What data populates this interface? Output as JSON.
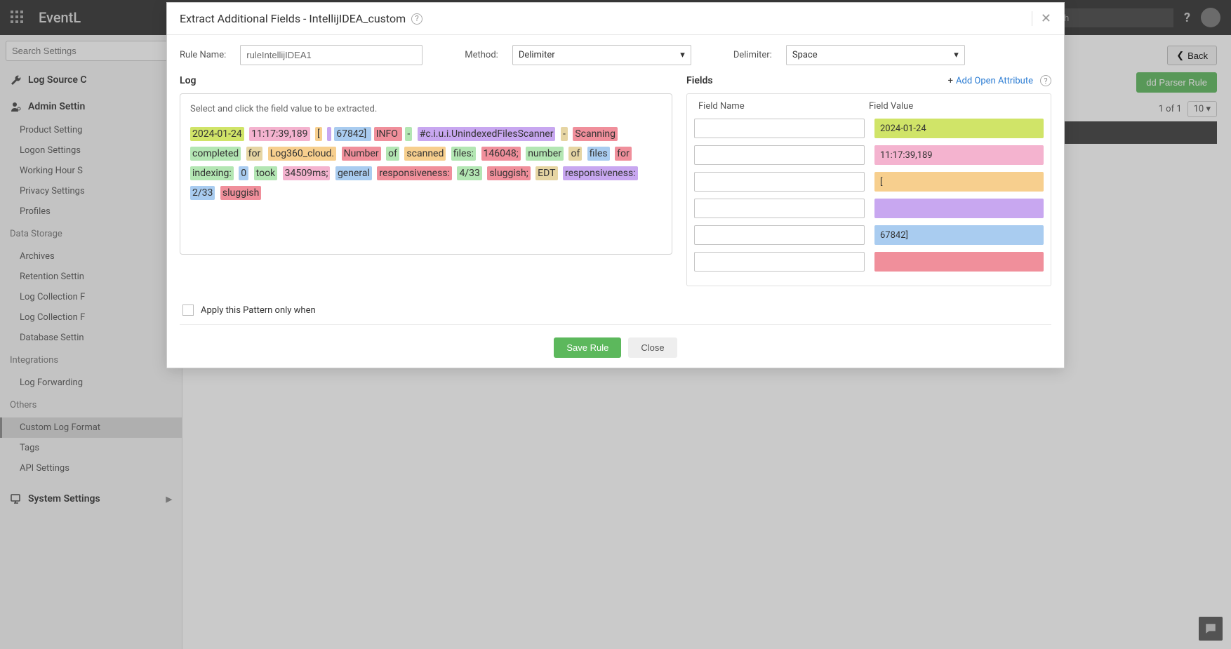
{
  "topbar": {
    "brand": "EventL",
    "search_placeholder": "Search",
    "help_label": "?"
  },
  "sidebar": {
    "search_placeholder": "Search Settings",
    "groups": {
      "log_source": "Log Source C",
      "admin": "Admin Settin",
      "data_storage": "Data Storage",
      "integrations": "Integrations",
      "others": "Others",
      "system": "System Settings"
    },
    "items": {
      "product_setting": "Product Setting",
      "logon_settings": "Logon Settings",
      "working_hour": "Working Hour S",
      "privacy": "Privacy Settings",
      "profiles": "Profiles",
      "archives": "Archives",
      "retention": "Retention Settin",
      "log_coll1": "Log Collection F",
      "log_coll2": "Log Collection F",
      "db_settin": "Database Settin",
      "log_fwd": "Log Forwarding",
      "custom_log": "Custom Log Format",
      "tags": "Tags",
      "api": "API Settings"
    }
  },
  "main": {
    "back": "Back",
    "add_rule": "dd Parser Rule",
    "pager_text": "1 of 1",
    "pgsize": "10"
  },
  "modal": {
    "title": "Extract Additional Fields - IntellijIDEA_custom",
    "rule_name_label": "Rule Name:",
    "rule_name_value": "ruleIntellijIDEA1",
    "method_label": "Method:",
    "method_value": "Delimiter",
    "delim_label": "Delimiter:",
    "delim_value": "Space",
    "log_title": "Log",
    "fields_title": "Fields",
    "add_open_attr": "Add Open Attribute",
    "log_hint": "Select and click the field value to be extracted.",
    "field_name_header": "Field Name",
    "field_value_header": "Field Value",
    "apply_label": "Apply this Pattern only when",
    "save": "Save Rule",
    "close": "Close"
  },
  "log_tokens": [
    {
      "t": "2024-01-24",
      "c": "c1"
    },
    {
      "t": "11:17:39,189",
      "c": "c2"
    },
    {
      "t": "[",
      "c": "c3"
    },
    {
      "t": "",
      "c": "c4"
    },
    {
      "t": " 67842] ",
      "c": "c5"
    },
    {
      "t": " INFO ",
      "c": "c6"
    },
    {
      "t": "-",
      "c": "c7"
    },
    {
      "t": "#c.i.u.i.UnindexedFilesScanner",
      "c": "c4"
    },
    {
      "t": "-",
      "c": "c8"
    },
    {
      "t": "Scanning",
      "c": "c6"
    },
    {
      "t": "completed",
      "c": "c7"
    },
    {
      "t": "for",
      "c": "c8"
    },
    {
      "t": "Log360_cloud.",
      "c": "c3"
    },
    {
      "t": "Number",
      "c": "c6"
    },
    {
      "t": "of",
      "c": "c7"
    },
    {
      "t": "scanned",
      "c": "c3"
    },
    {
      "t": "files:",
      "c": "c7"
    },
    {
      "t": "146048;",
      "c": "c6"
    },
    {
      "t": "number",
      "c": "c7"
    },
    {
      "t": "of",
      "c": "c8"
    },
    {
      "t": "files",
      "c": "c5"
    },
    {
      "t": "for",
      "c": "c6"
    },
    {
      "t": "indexing:",
      "c": "c7"
    },
    {
      "t": "0",
      "c": "c5"
    },
    {
      "t": "took",
      "c": "c7"
    },
    {
      "t": "34509ms;",
      "c": "c2"
    },
    {
      "t": "general",
      "c": "c5"
    },
    {
      "t": "responsiveness:",
      "c": "c6"
    },
    {
      "t": "4/33",
      "c": "c7"
    },
    {
      "t": "sluggish;",
      "c": "c6"
    },
    {
      "t": "EDT",
      "c": "c8"
    },
    {
      "t": "responsiveness:",
      "c": "c4"
    },
    {
      "t": "2/33",
      "c": "c5"
    },
    {
      "t": "sluggish",
      "c": "c6"
    }
  ],
  "field_rows": [
    {
      "v": "2024-01-24",
      "c": "c1"
    },
    {
      "v": "11:17:39,189",
      "c": "c2"
    },
    {
      "v": "[",
      "c": "c3"
    },
    {
      "v": "",
      "c": "c4"
    },
    {
      "v": "67842]",
      "c": "c5"
    },
    {
      "v": "",
      "c": "c6"
    }
  ]
}
